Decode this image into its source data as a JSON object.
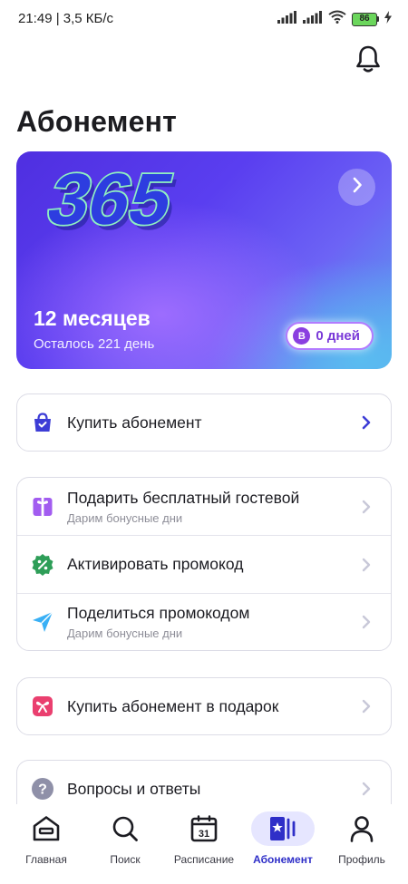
{
  "status_bar": {
    "time": "21:49 | 3,5 КБ/с",
    "battery_level": "86"
  },
  "page": {
    "title": "Абонемент"
  },
  "subscription_card": {
    "logo_text": "365",
    "title": "12 месяцев",
    "subtitle": "Осталось 221 день",
    "bonus_badge_symbol": "B",
    "bonus_days": "0 дней",
    "colors": {
      "gradient_start": "#4f2fe0",
      "gradient_mid": "#a06eff",
      "gradient_end": "#5aa8ee",
      "logo_fill": "#2d3de0",
      "logo_outline": "#8ff0c0"
    }
  },
  "menu_groups": [
    {
      "items": [
        {
          "label": "Купить абонемент",
          "hint": "",
          "icon": "shopping-bag-icon",
          "chevron_color": "#3d3dd6"
        }
      ]
    },
    {
      "items": [
        {
          "label": "Подарить бесплатный гостевой",
          "hint": "Дарим бонусные дни",
          "icon": "gift-icon",
          "chevron_color": "#c8c8d8"
        },
        {
          "label": "Активировать промокод",
          "hint": "",
          "icon": "percent-badge-icon",
          "chevron_color": "#c8c8d8"
        },
        {
          "label": "Поделиться промокодом",
          "hint": "Дарим бонусные дни",
          "icon": "paper-plane-icon",
          "chevron_color": "#c8c8d8"
        }
      ]
    },
    {
      "items": [
        {
          "label": "Купить абонемент в подарок",
          "hint": "",
          "icon": "gift-bow-icon",
          "chevron_color": "#c8c8d8"
        }
      ]
    },
    {
      "items": [
        {
          "label": "Вопросы и ответы",
          "hint": "",
          "icon": "question-icon",
          "chevron_color": "#c8c8d8"
        }
      ]
    }
  ],
  "bottom_nav": {
    "active": "Абонемент",
    "items": [
      {
        "label": "Главная",
        "icon": "home-icon"
      },
      {
        "label": "Поиск",
        "icon": "search-icon"
      },
      {
        "label": "Расписание",
        "icon": "calendar-icon",
        "calendar_day": "31"
      },
      {
        "label": "Абонемент",
        "icon": "membership-card-icon"
      },
      {
        "label": "Профиль",
        "icon": "profile-icon"
      }
    ]
  },
  "colors": {
    "accent": "#3d3dd6",
    "active_nav_bg": "#e6e6ff",
    "battery": "#6bd65c",
    "gift_icon": "#a25cf0",
    "percent_icon": "#2e9e58",
    "plane_icon": "#3ab0f5",
    "gift_bow_icon": "#ea3f6f",
    "question_icon": "#8f90a8"
  }
}
